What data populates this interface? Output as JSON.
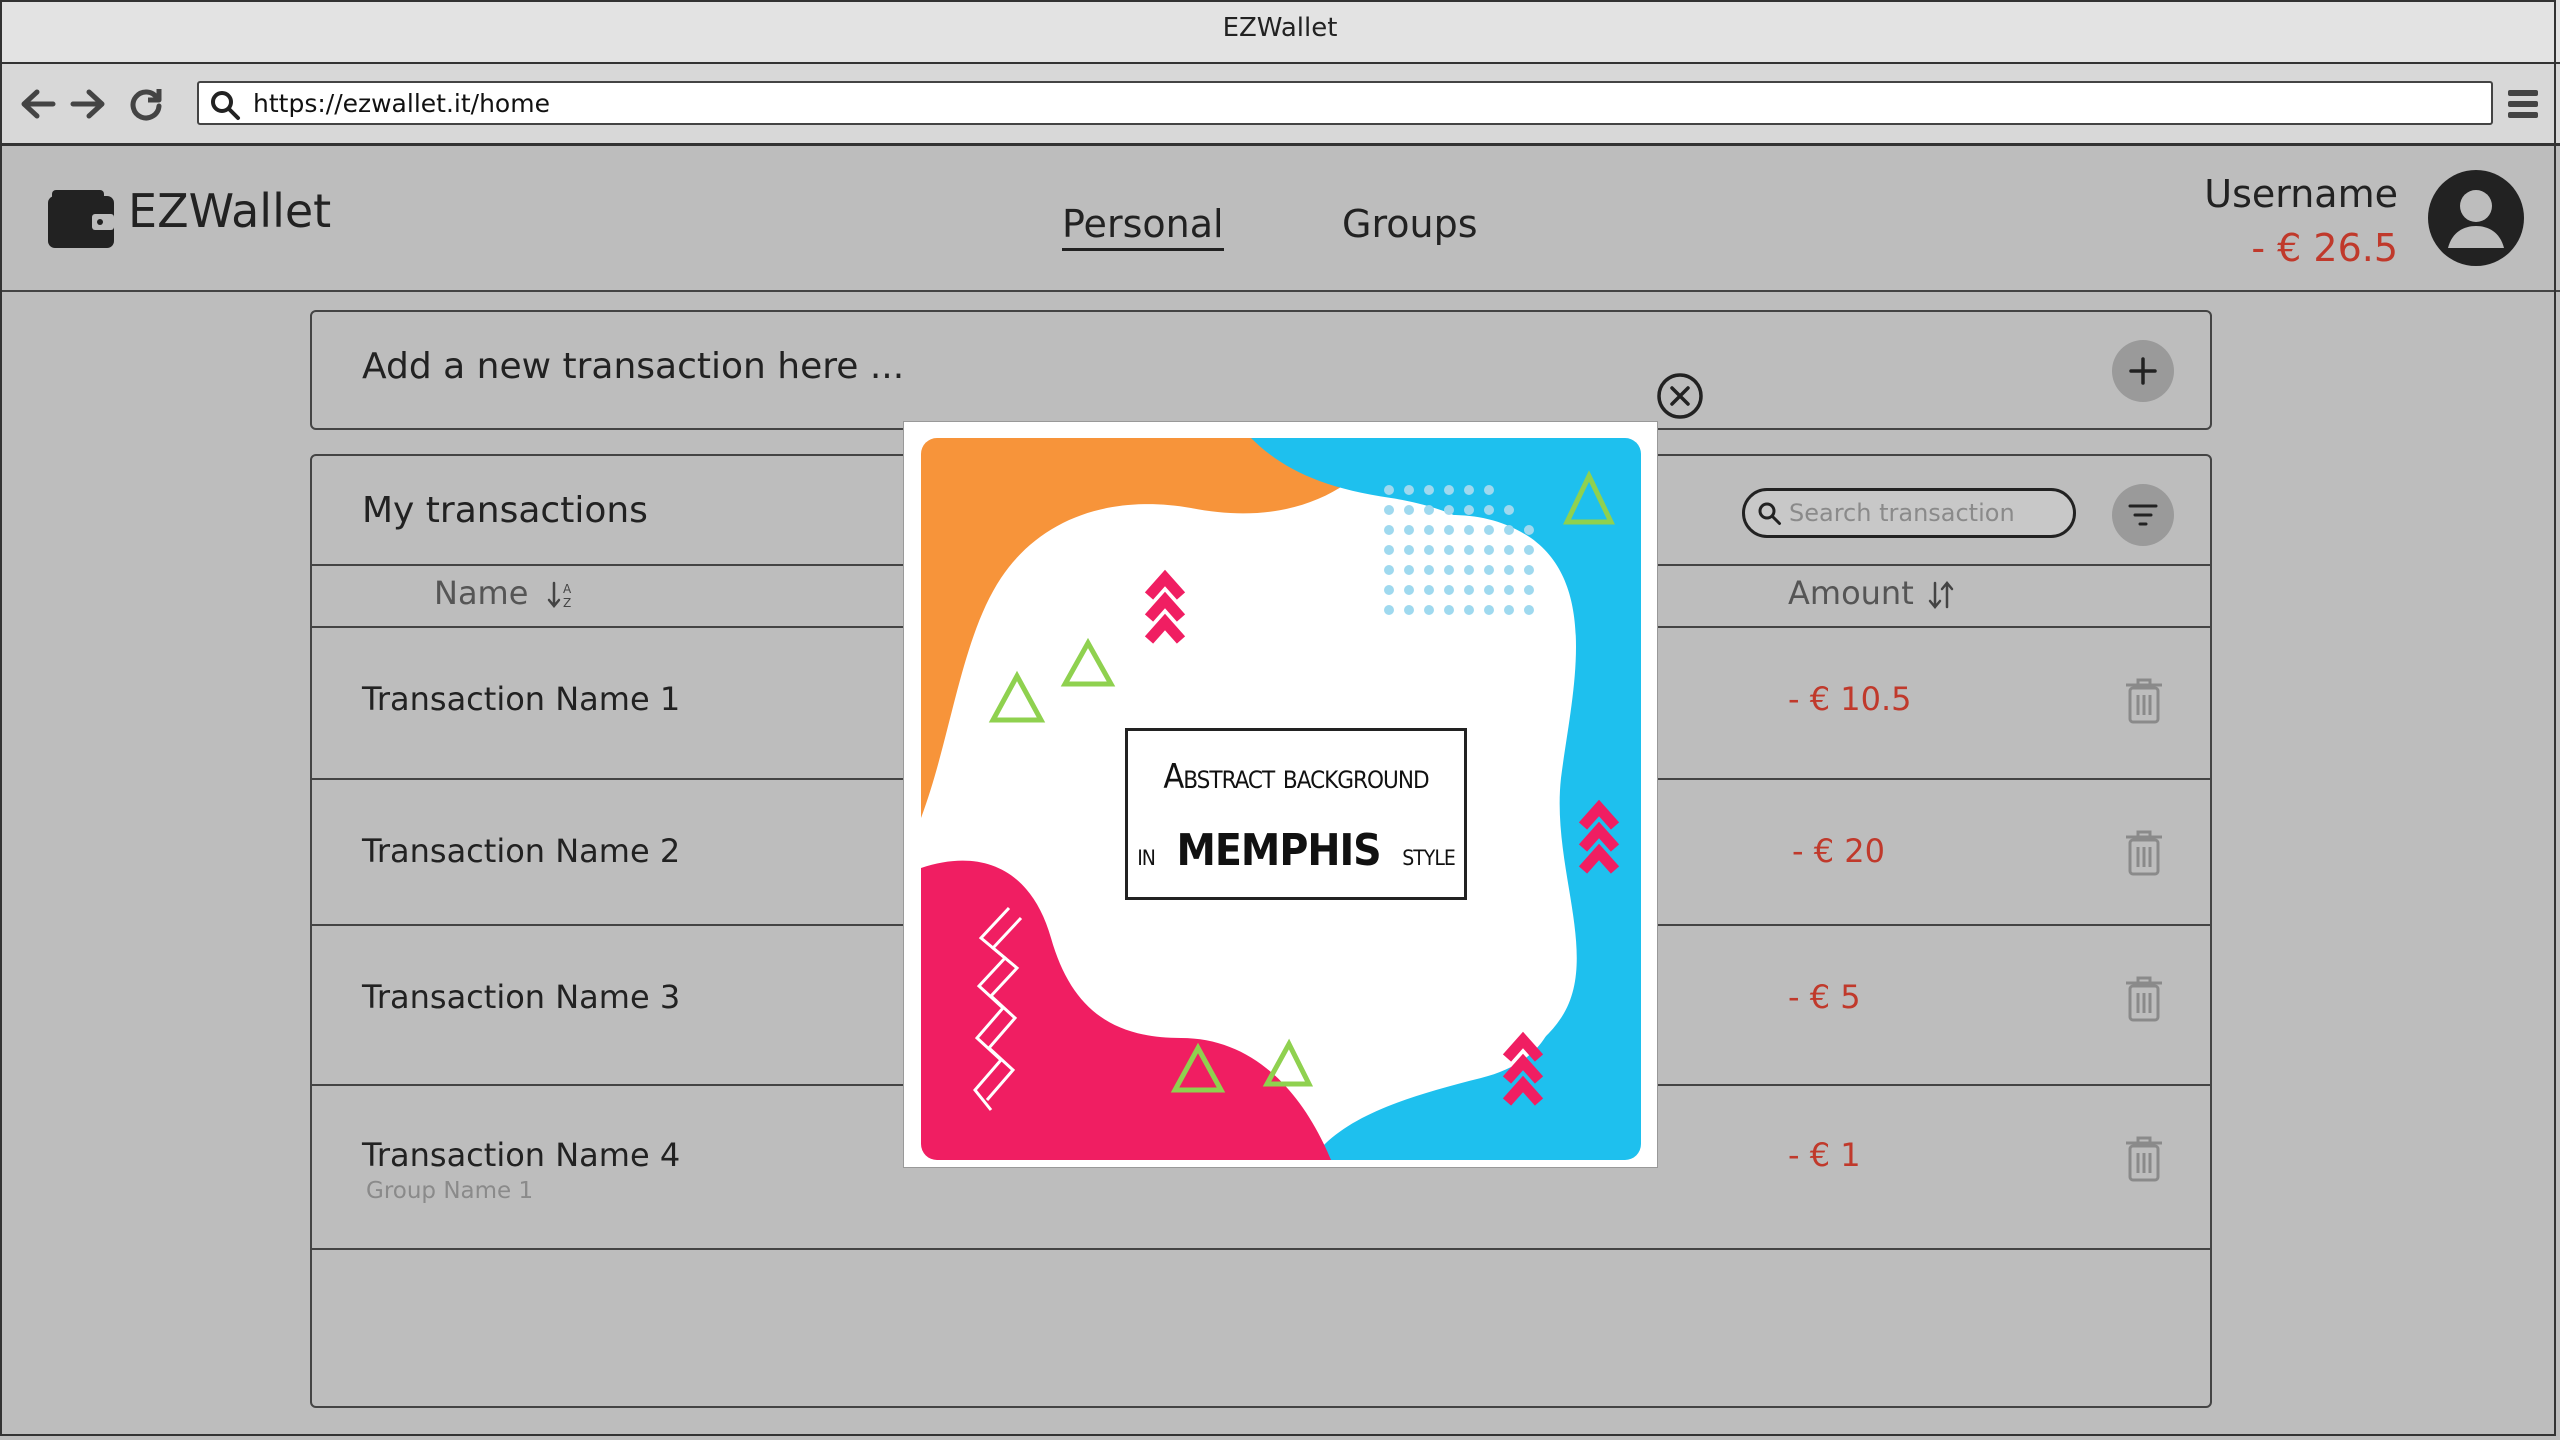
{
  "window": {
    "title": "EZWallet"
  },
  "browser": {
    "url": "https://ezwallet.it/home"
  },
  "app": {
    "name": "EZWallet",
    "tabs": [
      {
        "label": "Personal",
        "active": true
      },
      {
        "label": "Groups",
        "active": false
      }
    ],
    "user": {
      "name": "Username",
      "balance": "- € 26.5"
    }
  },
  "add_transaction": {
    "placeholder": "Add a new transaction here ..."
  },
  "transactions": {
    "title": "My transactions",
    "search_placeholder": "Search transaction",
    "columns": {
      "name": "Name",
      "amount": "Amount"
    },
    "rows": [
      {
        "name": "Transaction Name 1",
        "group": "",
        "amount": "- € 10.5"
      },
      {
        "name": "Transaction Name 2",
        "group": "",
        "amount": "- € 20"
      },
      {
        "name": "Transaction Name 3",
        "group": "",
        "amount": "- € 5"
      },
      {
        "name": "Transaction Name 4",
        "group": "Group Name 1",
        "amount": "- € 1"
      }
    ]
  },
  "modal": {
    "image_text_line1": "Abstract background",
    "image_text_in": "in",
    "image_text_memphis": "MEMPHIS",
    "image_text_style": "style"
  },
  "colors": {
    "negative": "#c0392b",
    "accent_pink": "#f01e62",
    "accent_blue": "#1ec0ee",
    "accent_orange": "#f7943a",
    "accent_green": "#8fd14f"
  }
}
